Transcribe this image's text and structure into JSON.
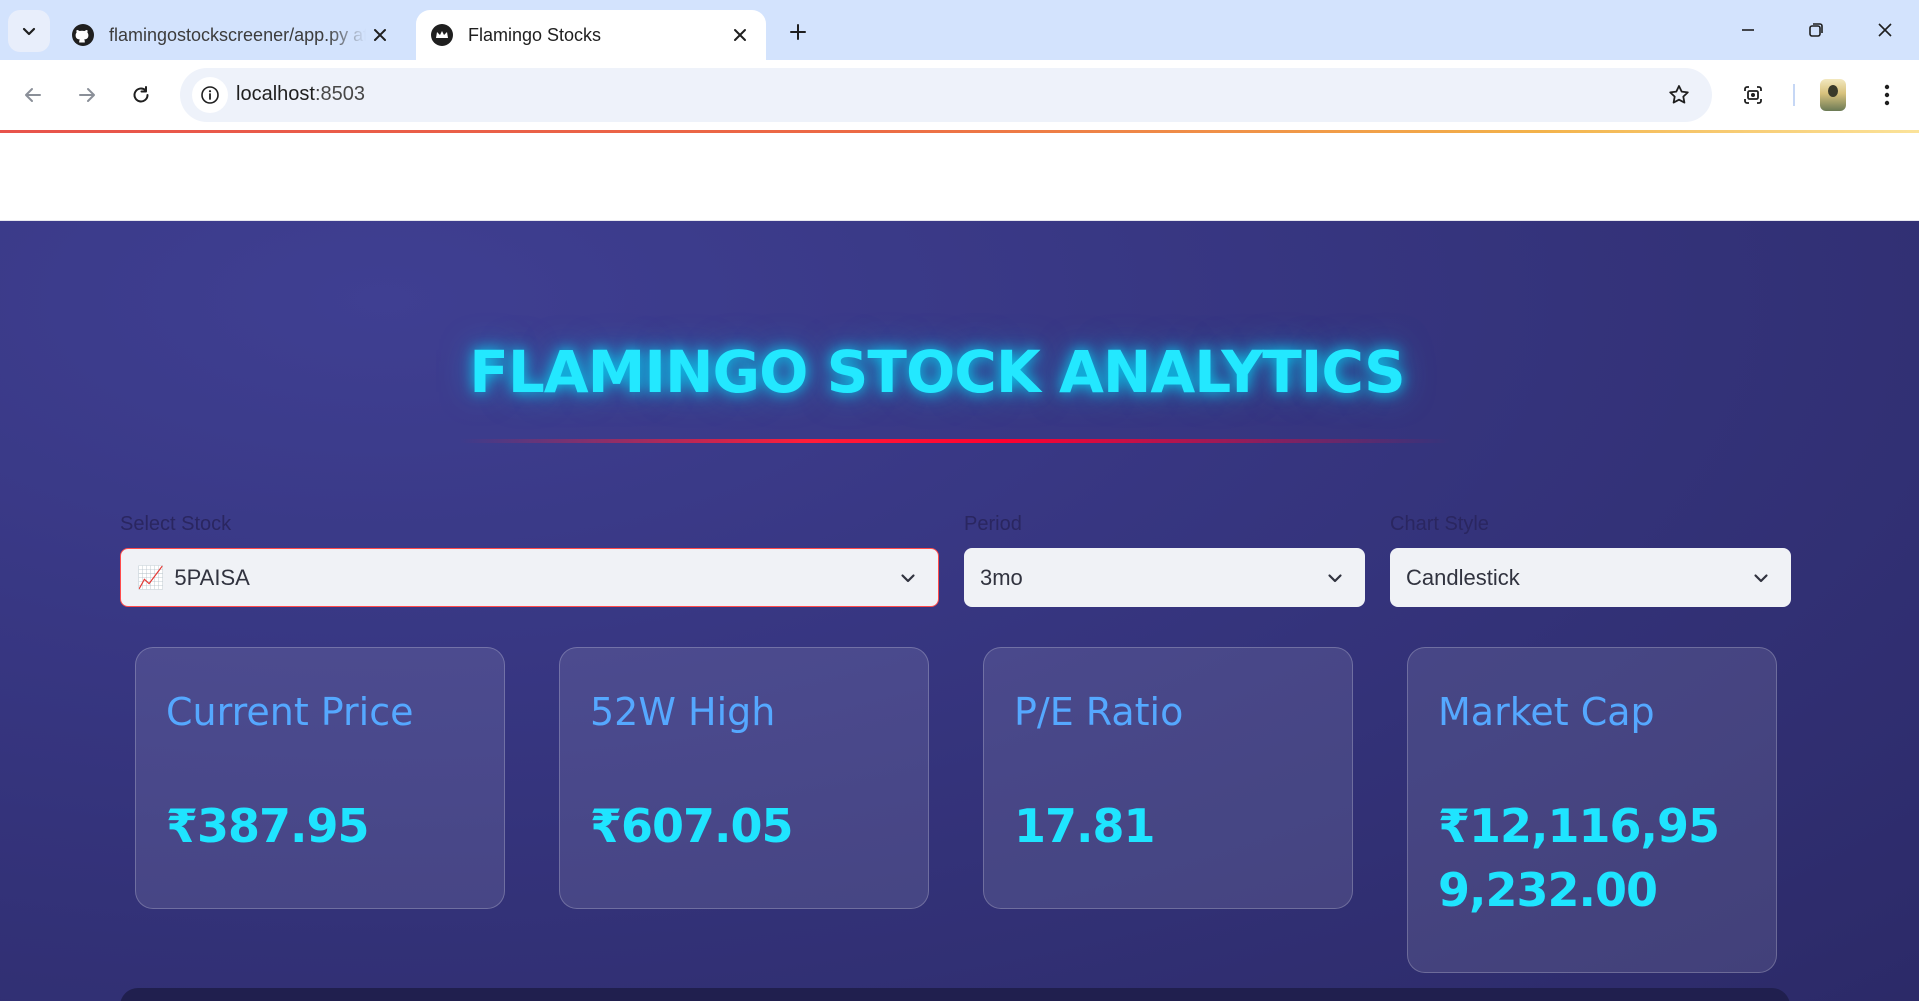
{
  "browser": {
    "tabs": [
      {
        "title": "flamingostockscreener/app.py at main",
        "favicon": "github-icon",
        "active": false
      },
      {
        "title": "Flamingo Stocks",
        "favicon": "streamlit-crown-icon",
        "active": true
      }
    ],
    "url_host": "localhost",
    "url_port": ":8503"
  },
  "app": {
    "title": "FLAMINGO STOCK ANALYTICS",
    "controls": {
      "stock": {
        "label": "Select Stock",
        "emoji": "📈",
        "value": "5PAISA"
      },
      "period": {
        "label": "Period",
        "value": "3mo"
      },
      "chart_style": {
        "label": "Chart Style",
        "value": "Candlestick"
      }
    },
    "metrics": [
      {
        "label": "Current Price",
        "value": "₹387.95"
      },
      {
        "label": "52W High",
        "value": "₹607.05"
      },
      {
        "label": "P/E Ratio",
        "value": "17.81"
      },
      {
        "label": "Market Cap",
        "value": "₹12,116,959,232.00"
      }
    ]
  },
  "colors": {
    "title": "#23e8ff",
    "metric_label": "#55a8ff",
    "metric_value": "#1fe4ff",
    "accent_rule": "#ff1d3a",
    "app_background": "#36357f"
  }
}
